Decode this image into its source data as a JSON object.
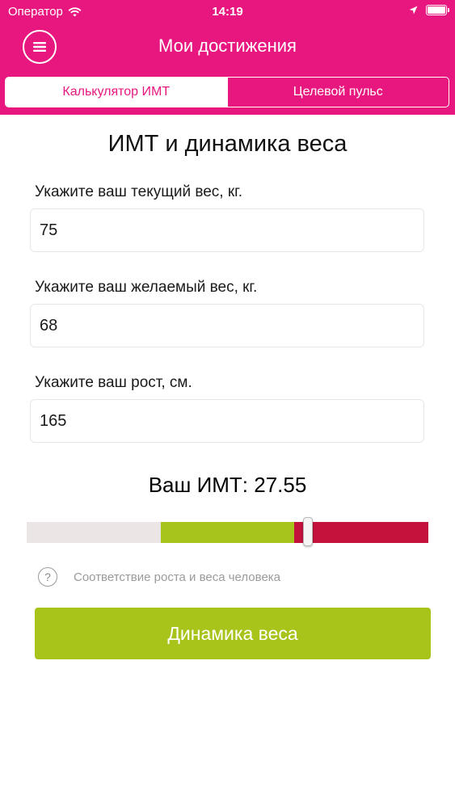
{
  "status_bar": {
    "carrier": "Оператор",
    "time": "14:19"
  },
  "nav": {
    "title": "Мои достижения",
    "tabs": [
      {
        "label": "Калькулятор ИМТ",
        "active": true
      },
      {
        "label": "Целевой пульс",
        "active": false
      }
    ]
  },
  "main": {
    "title": "ИМТ и динамика веса",
    "fields": [
      {
        "label": "Укажите ваш текущий вес, кг.",
        "value": "75"
      },
      {
        "label": "Укажите ваш желаемый вес, кг.",
        "value": "68"
      },
      {
        "label": "Укажите ваш рост, см.",
        "value": "165"
      }
    ],
    "bmi_label": "Ваш ИМТ: 27.55",
    "bmi_value": 27.55,
    "scale_position_fraction": 0.7,
    "help_text": "Соответствие роста и веса человека",
    "button_label": "Динамика веса"
  },
  "colors": {
    "brand": "#e8177f",
    "scale_low": "#ebe5e5",
    "scale_normal": "#a6c41c",
    "scale_high": "#c3123c",
    "button": "#a8c31a"
  }
}
